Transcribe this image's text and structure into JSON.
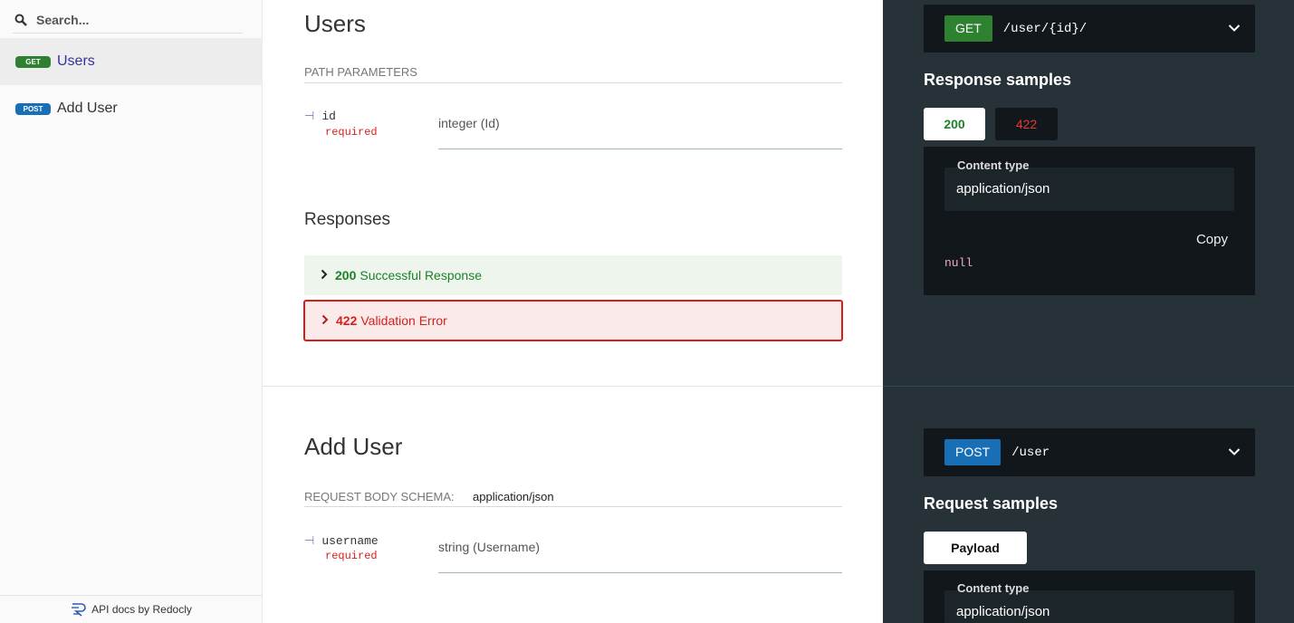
{
  "sidebar": {
    "search_placeholder": "Search...",
    "items": [
      {
        "method": "GET",
        "label": "Users"
      },
      {
        "method": "POST",
        "label": "Add User"
      }
    ],
    "footer": "API docs by Redocly"
  },
  "users": {
    "title": "Users",
    "path_params_label": "PATH PARAMETERS",
    "param": {
      "name": "id",
      "required": "required",
      "type": "integer (Id)"
    },
    "responses_title": "Responses",
    "responses": [
      {
        "code": "200",
        "text": "Successful Response"
      },
      {
        "code": "422",
        "text": "Validation Error"
      }
    ]
  },
  "add_user": {
    "title": "Add User",
    "schema_label": "REQUEST BODY SCHEMA:",
    "schema_value": "application/json",
    "param": {
      "name": "username",
      "required": "required",
      "type": "string (Username)"
    }
  },
  "right": {
    "get": {
      "method": "GET",
      "path": "/user/{id}/",
      "panel_title": "Response samples",
      "tabs": [
        "200",
        "422"
      ],
      "content_type_label": "Content type",
      "content_type_value": "application/json",
      "copy": "Copy",
      "body": "null"
    },
    "post": {
      "method": "POST",
      "path": "/user",
      "panel_title": "Request samples",
      "tab": "Payload",
      "content_type_label": "Content type",
      "content_type_value": "application/json"
    }
  },
  "colors": {
    "get_green": "#2f8132",
    "post_blue": "#186fb5",
    "error_red": "#d41f1c",
    "right_bg": "#263238",
    "code_bg": "#11171a"
  }
}
